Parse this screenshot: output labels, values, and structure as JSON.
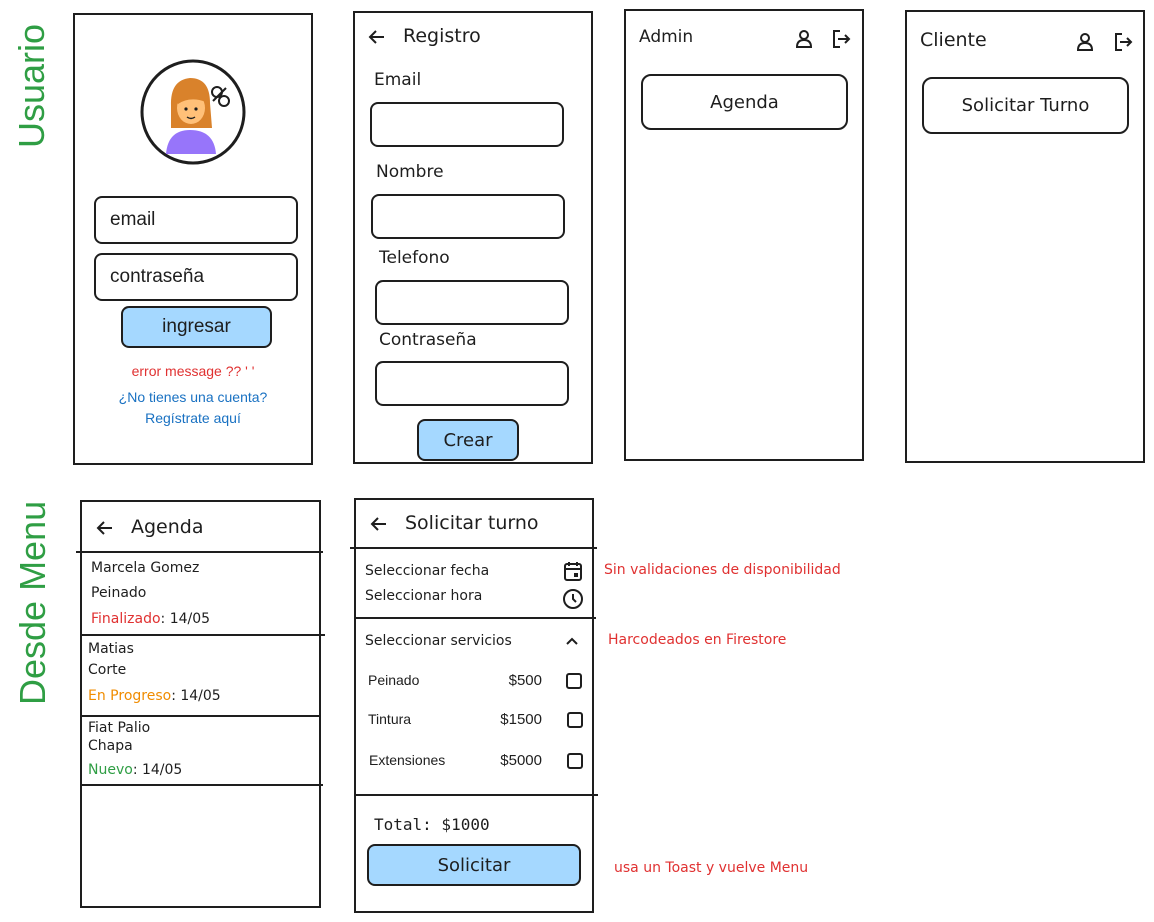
{
  "sections": {
    "usuario": "Usuario",
    "desde_menu": "Desde Menu"
  },
  "login": {
    "email_placeholder": "email",
    "password_placeholder": "contraseña",
    "submit": "ingresar",
    "error": "error message ?? ' '",
    "no_account": "¿No tienes una cuenta?",
    "register_link": "Regístrate aquí"
  },
  "registro": {
    "title": "Registro",
    "labels": [
      "Email",
      "Nombre",
      "Telefono",
      "Contraseña"
    ],
    "submit": "Crear"
  },
  "admin": {
    "title": "Admin",
    "menu_button": "Agenda"
  },
  "cliente": {
    "title": "Cliente",
    "menu_button": "Solicitar Turno"
  },
  "agenda": {
    "title": "Agenda",
    "items": [
      {
        "name": "Marcela Gomez",
        "service": "Peinado",
        "status": "Finalizado",
        "status_color": "#e03131",
        "date": ": 14/05"
      },
      {
        "name": "Matias",
        "service": "Corte",
        "status": "En Progreso",
        "status_color": "#f08c00",
        "date": ": 14/05"
      },
      {
        "name": "Fiat Palio",
        "service": "Chapa",
        "status": "Nuevo",
        "status_color": "#2f9e44",
        "date": ": 14/05"
      }
    ]
  },
  "solicitar": {
    "title": "Solicitar turno",
    "date_label": "Seleccionar fecha",
    "time_label": "Seleccionar hora",
    "services_label": "Seleccionar servicios",
    "services": [
      {
        "name": "Peinado",
        "price": "$500"
      },
      {
        "name": "Tintura",
        "price": "$1500"
      },
      {
        "name": "Extensiones",
        "price": "$5000"
      }
    ],
    "total": "Total: $1000",
    "submit": "Solicitar"
  },
  "notes": {
    "no_validation": "Sin validaciones de disponibilidad",
    "hardcoded": "Harcodeados en Firestore",
    "toast": "usa un Toast y vuelve Menu"
  },
  "colors": {
    "section_label": "#2f9e44",
    "note": "#e03131",
    "button_blue": "#a5d8ff",
    "link": "#1971c2"
  }
}
